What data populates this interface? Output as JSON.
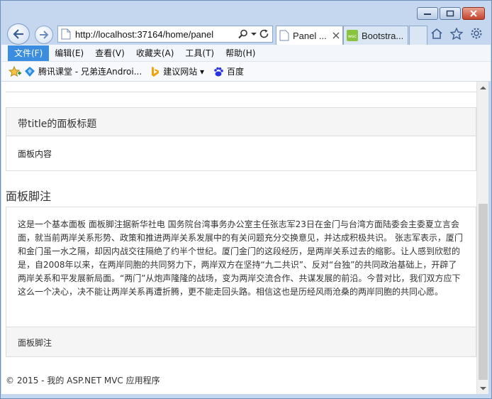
{
  "browser": {
    "address_url": "http://localhost:37164/home/panel",
    "tabs": [
      {
        "label": "Panel ..."
      },
      {
        "label": "Bootstra..."
      }
    ]
  },
  "menu": {
    "items": [
      "文件(F)",
      "编辑(E)",
      "查看(V)",
      "收藏夹(A)",
      "工具(T)",
      "帮助(H)"
    ]
  },
  "favorites": {
    "items": [
      "腾讯课堂 - 兄弟连Androi...",
      "建议网站 ▾",
      "百度"
    ]
  },
  "page": {
    "panel1": {
      "heading": "带title的面板标题",
      "body": "面板内容"
    },
    "section_title": "面板脚注",
    "panel2": {
      "body": "这是一个基本面板 面板脚注据新华社电 国务院台湾事务办公室主任张志军23日在金门与台湾方面陆委会主委夏立言会面，就当前两岸关系形势、政策和推进两岸关系发展中的有关问题充分交换意见，并达成积极共识。 张志军表示，厦门和金门虽一水之隔，却因内战交往隔绝了约半个世纪。厦门金门的这段经历，是两岸关系过去的缩影。让人感到欣慰的是，自2008年以来，在两岸同胞的共同努力下，两岸双方在坚持“九二共识”、反对“台独”的共同政治基础上，开辟了两岸关系和平发展新局面。“两门”从炮声隆隆的战场，变为两岸交流合作、共谋发展的前沿。今昔对比，我们双方应下这么一个决心，决不能让两岸关系再遭折腾，更不能走回头路。相信这也是历经风雨沧桑的两岸同胞的共同心愿。",
      "footer": "面板脚注"
    },
    "footer": "© 2015 - 我的 ASP.NET MVC 应用程序"
  },
  "colors": {
    "menu_active_bg": "#3b8de0",
    "panel_heading_bg": "#f5f5f5",
    "panel_border": "#dddddd"
  }
}
